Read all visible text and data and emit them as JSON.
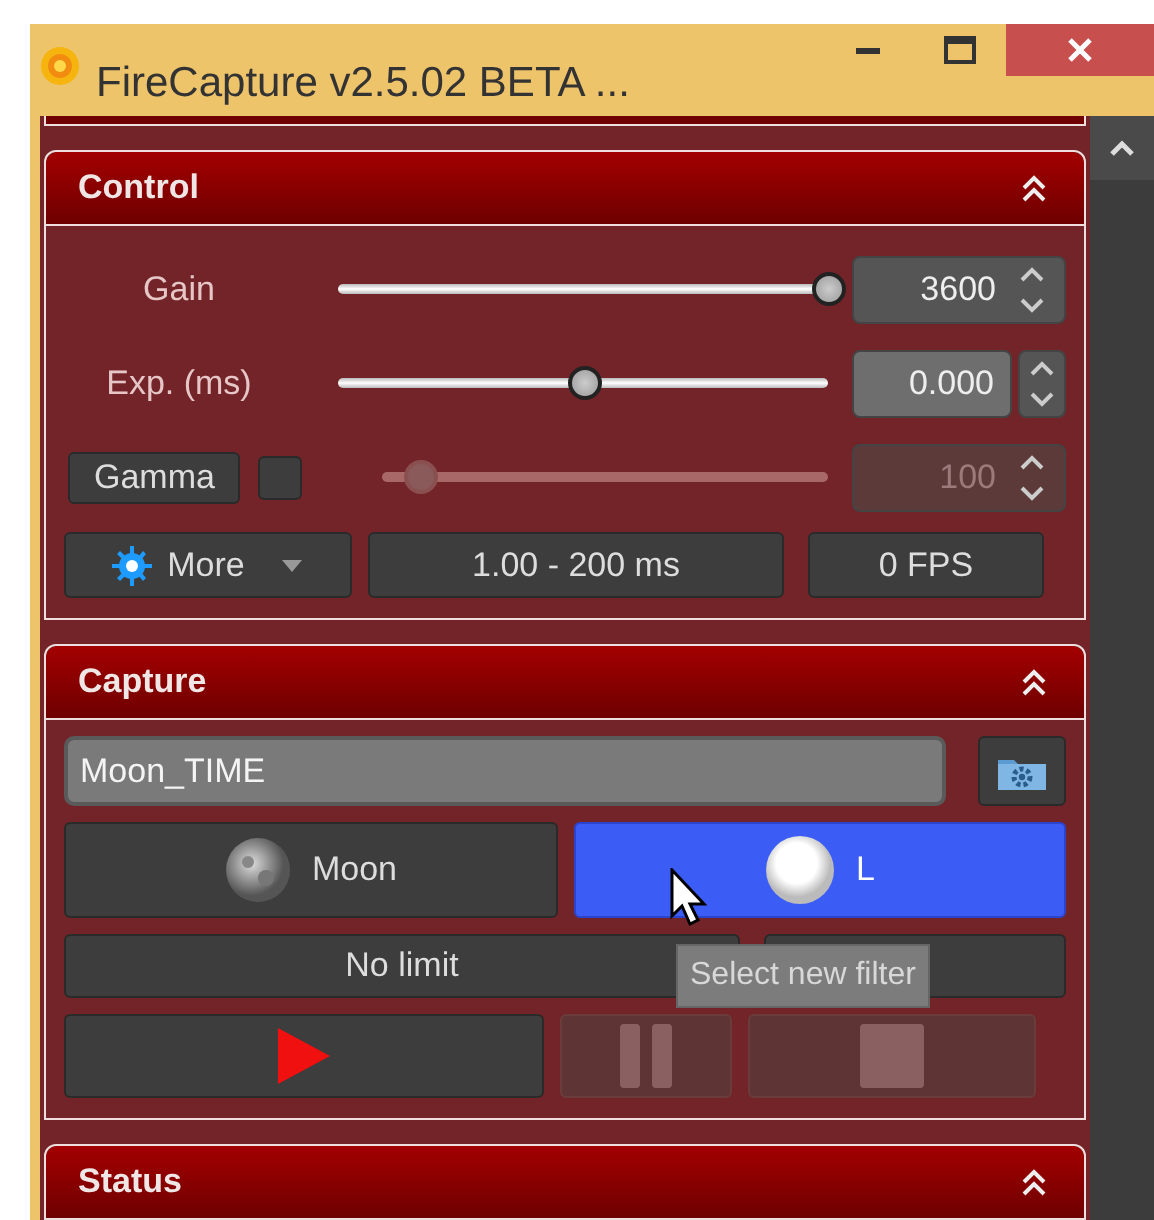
{
  "window": {
    "title": "FireCapture v2.5.02 BETA ..."
  },
  "control": {
    "title": "Control",
    "expanded": true,
    "rows": [
      {
        "kind": "slider",
        "label": "Gain",
        "level": 1.0,
        "value": "3600",
        "focused": false
      },
      {
        "kind": "slider",
        "label": "Exp. (ms)",
        "level": 0.5,
        "value": "0.000",
        "focused": true
      },
      {
        "kind": "toggle-slider",
        "label": "Gamma",
        "checked": false,
        "disabled": true,
        "level": 0.085,
        "value": "100"
      }
    ],
    "more_button": "More",
    "exposure_range": "1.00 - 200 ms",
    "fps": "0 FPS"
  },
  "capture": {
    "title": "Capture",
    "expanded": true,
    "filename": "Moon_TIME",
    "profiles": [
      {
        "label": "Moon",
        "kind": "moon",
        "selected": false
      },
      {
        "label": "L",
        "kind": "filter",
        "selected": true
      }
    ],
    "limit": "No limit",
    "transport": [
      {
        "kind": "play",
        "disabled": false
      },
      {
        "kind": "pause",
        "disabled": true
      },
      {
        "kind": "stop",
        "disabled": true
      }
    ],
    "tooltip": "Select new filter"
  },
  "status": {
    "title": "Status",
    "expanded": true
  }
}
